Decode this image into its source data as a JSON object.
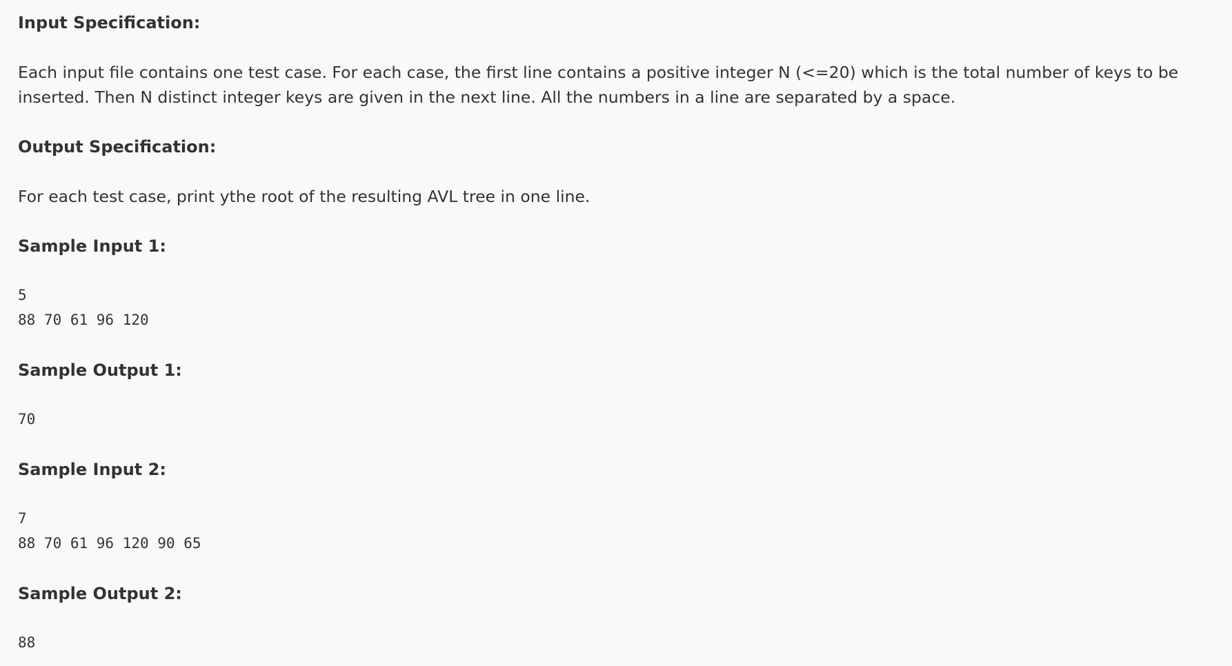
{
  "input_spec": {
    "heading": "Input Specification:",
    "line1": "Each input file contains one test case. For each case, the first line contains a positive integer N (<=20) which is the total number of keys to be",
    "line2": "inserted. Then N distinct integer keys are given in the next line. All the numbers in a line are separated by a space."
  },
  "output_spec": {
    "heading": "Output Specification:",
    "text": "For each test case, print ythe root of the resulting AVL tree in one line."
  },
  "samples": [
    {
      "input_heading": "Sample Input 1:",
      "input_lines": [
        "5",
        "88 70 61 96 120"
      ],
      "output_heading": "Sample Output 1:",
      "output": "70"
    },
    {
      "input_heading": "Sample Input 2:",
      "input_lines": [
        "7",
        "88 70 61 96 120 90 65"
      ],
      "output_heading": "Sample Output 2:",
      "output": "88"
    }
  ]
}
